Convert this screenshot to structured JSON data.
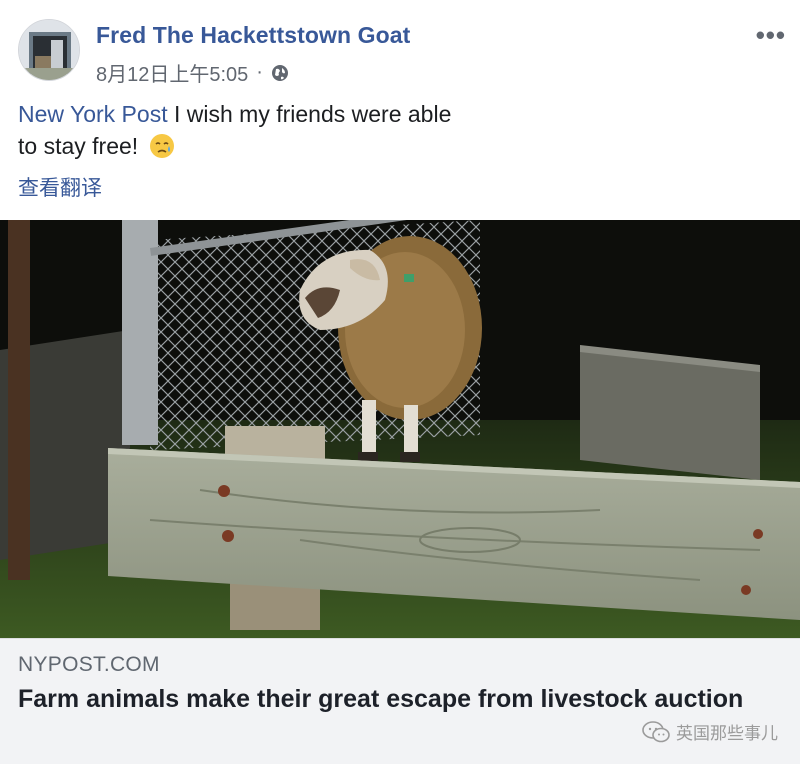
{
  "post": {
    "author": "Fred The Hackettstown Goat",
    "timestamp": "8月12日上午5:05",
    "separator": "·",
    "privacy_icon": "globe-icon",
    "more_label": "•••",
    "mention": "New York Post",
    "text_line1": " I wish my friends were able",
    "text_line2": "to stay free!",
    "emoji": "sad-sweat-emoji",
    "translate_label": "查看翻译"
  },
  "link_preview": {
    "domain": "NYPOST.COM",
    "headline": "Farm animals make their great escape from livestock auction"
  },
  "watermark": {
    "text": "英国那些事儿",
    "icon": "wechat-icon"
  },
  "colors": {
    "link_blue": "#385898",
    "meta_gray": "#616770",
    "card_bg": "#f2f3f5"
  }
}
